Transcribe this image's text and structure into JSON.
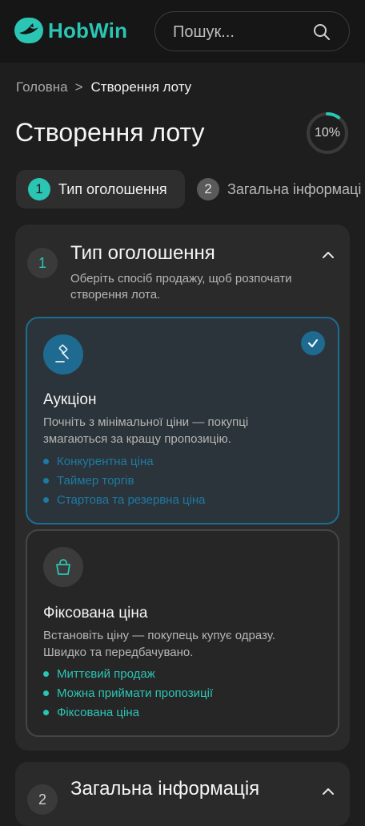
{
  "header": {
    "logo_text": "HobWin",
    "search_placeholder": "Пошук..."
  },
  "breadcrumb": {
    "home": "Головна",
    "separator": ">",
    "current": "Створення лоту"
  },
  "page": {
    "title": "Створення лоту",
    "progress_label": "10%",
    "progress_fraction": 0.1
  },
  "stepper": {
    "steps": [
      {
        "number": "1",
        "label": "Тип оголошення",
        "state": "active"
      },
      {
        "number": "2",
        "label": "Загальна інформаці",
        "state": "upcoming"
      }
    ]
  },
  "section_type": {
    "number": "1",
    "title": "Тип оголошення",
    "description": "Оберіть спосіб продажу, щоб розпочати створення лота.",
    "options": [
      {
        "title": "Аукціон",
        "description": "Почніть з мінімальної ціни — покупці змагаються за кращу пропозицію.",
        "icon": "gavel-icon",
        "selected": true,
        "features": [
          "Конкурентна ціна",
          "Таймер торгів",
          "Стартова та резервна ціна"
        ]
      },
      {
        "title": "Фіксована ціна",
        "description": "Встановіть ціну — покупець купує одразу. Швидко та передбачувано.",
        "icon": "shopping-bag-icon",
        "selected": false,
        "features": [
          "Миттєвий продаж",
          "Можна приймати пропозиції",
          "Фіксована ціна"
        ]
      }
    ]
  },
  "section_general": {
    "number": "2",
    "title": "Загальна інформація"
  },
  "colors": {
    "accent": "#2bc5b4",
    "selected": "#1f6a90",
    "background": "#1e1e1e",
    "card": "#2a2a2a"
  }
}
